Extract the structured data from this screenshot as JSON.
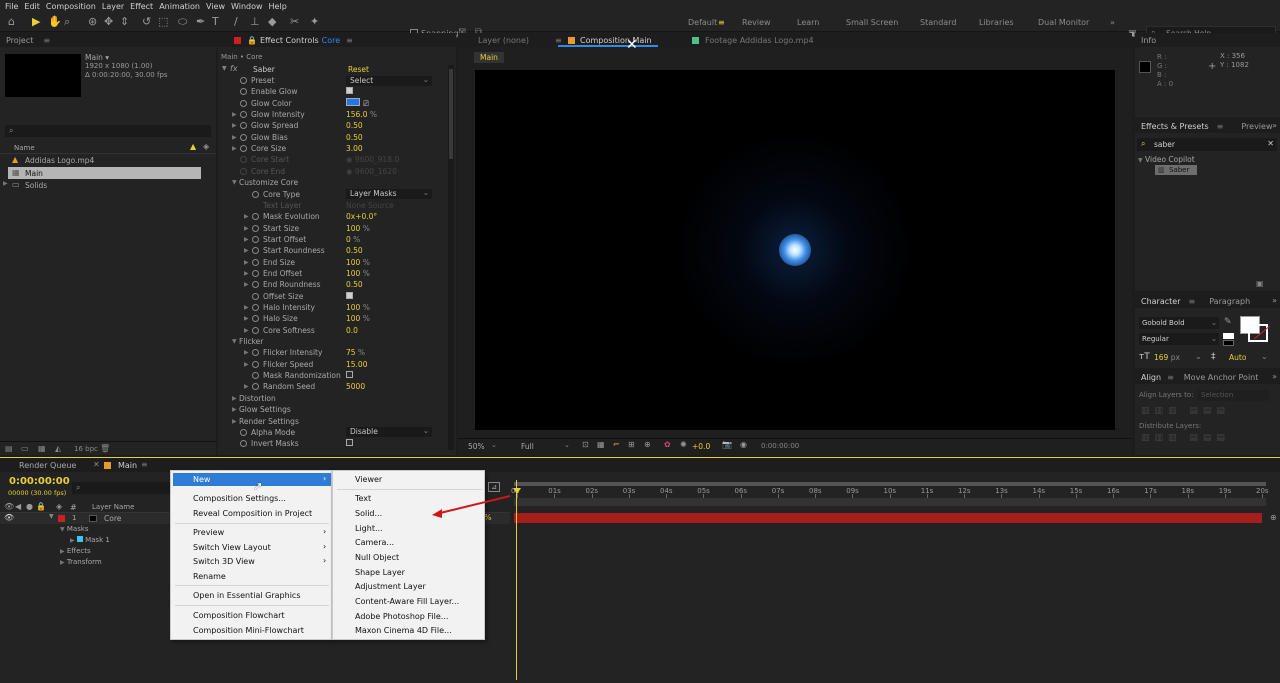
{
  "menubar": {
    "items": [
      "File",
      "Edit",
      "Composition",
      "Layer",
      "Effect",
      "Animation",
      "View",
      "Window",
      "Help"
    ]
  },
  "toolbar": {
    "snapping": "Snapping",
    "workspaces": [
      "Default",
      "Review",
      "Learn",
      "Small Screen",
      "Standard",
      "Libraries",
      "Dual Monitor"
    ],
    "search_placeholder": "Search Help"
  },
  "project": {
    "title": "Project",
    "comp_name": "Main ▾",
    "comp_info1": "1920 x 1080 (1.00)",
    "comp_info2": "Δ 0:00:20:00, 30.00 fps",
    "search_icon": "⌕",
    "col_name": "Name",
    "items": [
      {
        "label": "Addidas Logo.mp4"
      },
      {
        "label": "Main"
      },
      {
        "label": "Solids"
      }
    ],
    "bpc": "16 bpc"
  },
  "effect_controls": {
    "tab": "Effect Controls",
    "tab_layer": "Core",
    "breadcrumb": "Main • Core",
    "effect_name": "Saber",
    "reset": "Reset",
    "rows": [
      {
        "n": "Preset",
        "v": "Select",
        "t": "dropdown",
        "ind": 1
      },
      {
        "n": "Enable Glow",
        "v": "",
        "t": "check-on",
        "ind": 1
      },
      {
        "n": "Glow Color",
        "v": "",
        "t": "color",
        "ind": 1
      },
      {
        "n": "Glow Intensity",
        "v": "156.0",
        "u": "%",
        "t": "num",
        "ind": 1,
        "exp": 1
      },
      {
        "n": "Glow Spread",
        "v": "0.50",
        "t": "num",
        "ind": 1,
        "exp": 1
      },
      {
        "n": "Glow Bias",
        "v": "0.50",
        "t": "num",
        "ind": 1,
        "exp": 1
      },
      {
        "n": "Core Size",
        "v": "3.00",
        "t": "num",
        "ind": 1,
        "exp": 1
      },
      {
        "n": "Core Start",
        "v": "9600_918.0",
        "t": "dim",
        "ind": 1
      },
      {
        "n": "Core End",
        "v": "9600_1620",
        "t": "dim",
        "ind": 1
      },
      {
        "n": "Customize Core",
        "v": "",
        "t": "group",
        "ind": 0
      },
      {
        "n": "Core Type",
        "v": "Layer Masks",
        "t": "dropdown",
        "ind": 2
      },
      {
        "n": "Text Layer",
        "v": "None    Source",
        "t": "dimtext",
        "ind": 2
      },
      {
        "n": "Mask Evolution",
        "v": "0x+0.0°",
        "t": "num",
        "ind": 3,
        "exp": 1
      },
      {
        "n": "Start Size",
        "v": "100",
        "u": "%",
        "t": "num",
        "ind": 3,
        "exp": 1
      },
      {
        "n": "Start Offset",
        "v": "0",
        "u": "%",
        "t": "num",
        "ind": 3,
        "exp": 1
      },
      {
        "n": "Start Roundness",
        "v": "0.50",
        "t": "num",
        "ind": 3,
        "exp": 1
      },
      {
        "n": "End Size",
        "v": "100",
        "u": "%",
        "t": "num",
        "ind": 3,
        "exp": 1
      },
      {
        "n": "End Offset",
        "v": "100",
        "u": "%",
        "t": "num",
        "ind": 3,
        "exp": 1
      },
      {
        "n": "End Roundness",
        "v": "0.50",
        "t": "num",
        "ind": 3,
        "exp": 1
      },
      {
        "n": "Offset Size",
        "v": "",
        "t": "check-on",
        "ind": 3
      },
      {
        "n": "Halo Intensity",
        "v": "100",
        "u": "%",
        "t": "num",
        "ind": 3,
        "exp": 1
      },
      {
        "n": "Halo Size",
        "v": "100",
        "u": "%",
        "t": "num",
        "ind": 3,
        "exp": 1
      },
      {
        "n": "Core Softness",
        "v": "0.0",
        "t": "num",
        "ind": 3,
        "exp": 1
      },
      {
        "n": "Flicker",
        "v": "",
        "t": "group",
        "ind": 0
      },
      {
        "n": "Flicker Intensity",
        "v": "75",
        "u": "%",
        "t": "num",
        "ind": 3,
        "exp": 1
      },
      {
        "n": "Flicker Speed",
        "v": "15.00",
        "t": "num",
        "ind": 3,
        "exp": 1
      },
      {
        "n": "Mask Randomization",
        "v": "",
        "t": "check-off",
        "ind": 3
      },
      {
        "n": "Random Seed",
        "v": "5000",
        "t": "num",
        "ind": 3,
        "exp": 1
      },
      {
        "n": "Distortion",
        "v": "",
        "t": "groupc",
        "ind": 0
      },
      {
        "n": "Glow Settings",
        "v": "",
        "t": "groupc",
        "ind": 0
      },
      {
        "n": "Render Settings",
        "v": "",
        "t": "groupc",
        "ind": 0
      },
      {
        "n": "Alpha Mode",
        "v": "Disable",
        "t": "dropdown",
        "ind": 1
      },
      {
        "n": "Invert Masks",
        "v": "",
        "t": "check-off",
        "ind": 1
      }
    ]
  },
  "viewer": {
    "tab_layer": "Layer (none)",
    "tab_comp": "Composition Main",
    "tab_footage": "Footage Addidas Logo.mp4",
    "flow_tab": "Main",
    "zoom": "50%",
    "res": "Full",
    "exposure": "+0.0",
    "timecode": "0:00:00:00"
  },
  "info": {
    "title": "Info",
    "r": "R :",
    "g": "G :",
    "b": "B :",
    "a": "A :  0",
    "x": "X : 356",
    "y": "Y : 1082"
  },
  "effects_presets": {
    "title": "Effects & Presets",
    "tab2": "Preview",
    "search": "saber",
    "folder": "Video Copilot",
    "item": "Saber"
  },
  "character": {
    "title": "Character",
    "tab2": "Paragraph",
    "font": "Gobold Bold",
    "style": "Regular",
    "size": "169",
    "size_unit": "px",
    "leading": "Auto"
  },
  "align": {
    "title": "Align",
    "tab2": "Move Anchor Point",
    "align_to": "Align Layers to:",
    "align_to_val": "Selection",
    "distribute": "Distribute Layers:"
  },
  "timeline": {
    "tab_rq": "Render Queue",
    "tab_main": "Main",
    "time": "0:00:00:00",
    "fps": "00000 (30.00 fps)",
    "col_layer": "Layer Name",
    "layers": [
      {
        "n": "1",
        "name": "Core"
      }
    ],
    "sub": [
      "Masks",
      "Mask 1",
      "Effects",
      "Transform"
    ],
    "ticks": [
      "0s",
      "01s",
      "02s",
      "03s",
      "04s",
      "05s",
      "06s",
      "07s",
      "08s",
      "09s",
      "10s",
      "11s",
      "12s",
      "13s",
      "14s",
      "15s",
      "16s",
      "17s",
      "18s",
      "19s",
      "20s"
    ]
  },
  "context_menu": {
    "items": [
      "New",
      "Composition Settings...",
      "Reveal Composition in Project",
      "Preview",
      "Switch View Layout",
      "Switch 3D View",
      "Rename",
      "Open in Essential Graphics",
      "Composition Flowchart",
      "Composition Mini-Flowchart"
    ]
  },
  "submenu": {
    "items": [
      "Viewer",
      "Text",
      "Solid...",
      "Light...",
      "Camera...",
      "Null Object",
      "Shape Layer",
      "Adjustment Layer",
      "Content-Aware Fill Layer...",
      "Adobe Photoshop File...",
      "Maxon Cinema 4D File..."
    ]
  },
  "colors": {
    "accent": "#e8cf3a",
    "blue": "#2d8ceb",
    "red": "#a51d1d",
    "menu_hl": "#2e7cd6"
  }
}
